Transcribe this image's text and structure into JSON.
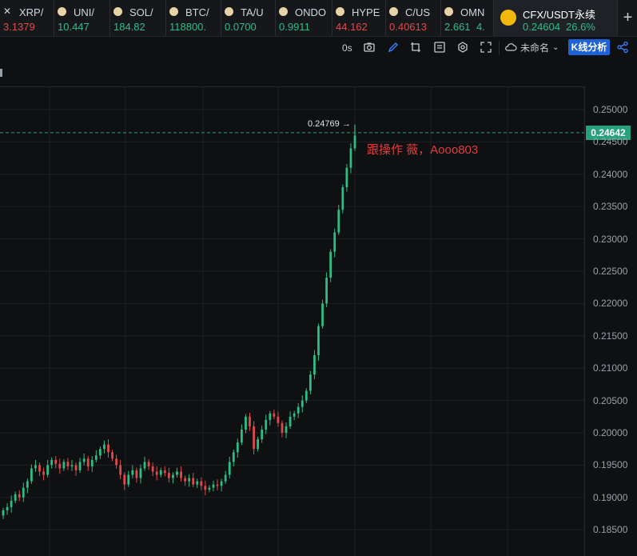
{
  "tabs": [
    {
      "name": "XRP/",
      "price": "3.1379",
      "price_color": "#e04a4a",
      "icon": "x-logo-icon"
    },
    {
      "name": "UNI/",
      "price": "10.447",
      "price_color": "#2ebd85",
      "icon": "coin-icon"
    },
    {
      "name": "SOL/",
      "price": "184.82",
      "price_color": "#2ebd85",
      "icon": "coin-icon"
    },
    {
      "name": "BTC/",
      "price": "118800.",
      "price_color": "#2ebd85",
      "icon": "coin-icon"
    },
    {
      "name": "TA/U",
      "price": "0.0700",
      "price_color": "#2ebd85",
      "icon": "coin-icon"
    },
    {
      "name": "ONDO",
      "price": "0.9911",
      "price_color": "#2ebd85",
      "icon": "coin-icon"
    },
    {
      "name": "HYPE",
      "price": "44.162",
      "price_color": "#e04a4a",
      "icon": "coin-icon"
    },
    {
      "name": "C/US",
      "price": "0.40613",
      "price_color": "#e04a4a",
      "icon": "coin-icon"
    },
    {
      "name": "OMN",
      "price": "2.661",
      "price_extra": "4.",
      "price_color": "#2ebd85",
      "icon": "coin-icon"
    }
  ],
  "active_tab": {
    "name": "CFX/USDT永续",
    "price": "0.24604",
    "change": "26.6%",
    "price_color": "#2ebd85",
    "icon": "binance-logo-icon"
  },
  "toolbar": {
    "interval": "0s",
    "layout_name": "未命名",
    "kline_button": "K线分析"
  },
  "chart_data": {
    "type": "candlestick",
    "yaxis": {
      "ticks": [
        "0.25000",
        "0.24500",
        "0.24000",
        "0.23500",
        "0.23000",
        "0.22500",
        "0.22000",
        "0.21500",
        "0.21000",
        "0.20500",
        "0.20000",
        "0.19500",
        "0.19000",
        "0.18500"
      ],
      "ylim": [
        0.1835,
        0.252
      ]
    },
    "last_price_label": "0.24642",
    "high_label": "0.24769",
    "annotation": "跟操作 薇，Aooo803",
    "up_color": "#2ebd85",
    "down_color": "#e04a4a",
    "closes": [
      0.188,
      0.1885,
      0.1895,
      0.1905,
      0.19,
      0.1915,
      0.1925,
      0.1945,
      0.195,
      0.194,
      0.1935,
      0.195,
      0.1958,
      0.1952,
      0.1945,
      0.1955,
      0.1948,
      0.195,
      0.1942,
      0.1955,
      0.196,
      0.1948,
      0.1958,
      0.1965,
      0.1975,
      0.1982,
      0.197,
      0.196,
      0.195,
      0.1935,
      0.192,
      0.1935,
      0.1942,
      0.193,
      0.1945,
      0.1955,
      0.1948,
      0.194,
      0.1935,
      0.1942,
      0.1938,
      0.193,
      0.1935,
      0.194,
      0.193,
      0.1925,
      0.193,
      0.192,
      0.1925,
      0.1918,
      0.1912,
      0.1915,
      0.192,
      0.1918,
      0.1925,
      0.1935,
      0.1955,
      0.197,
      0.1985,
      0.2005,
      0.2025,
      0.201,
      0.1975,
      0.199,
      0.2005,
      0.202,
      0.203,
      0.2025,
      0.2015,
      0.2,
      0.201,
      0.2025,
      0.203,
      0.204,
      0.205,
      0.2065,
      0.209,
      0.212,
      0.2165,
      0.22,
      0.224,
      0.228,
      0.231,
      0.2345,
      0.238,
      0.241,
      0.244,
      0.246
    ]
  }
}
